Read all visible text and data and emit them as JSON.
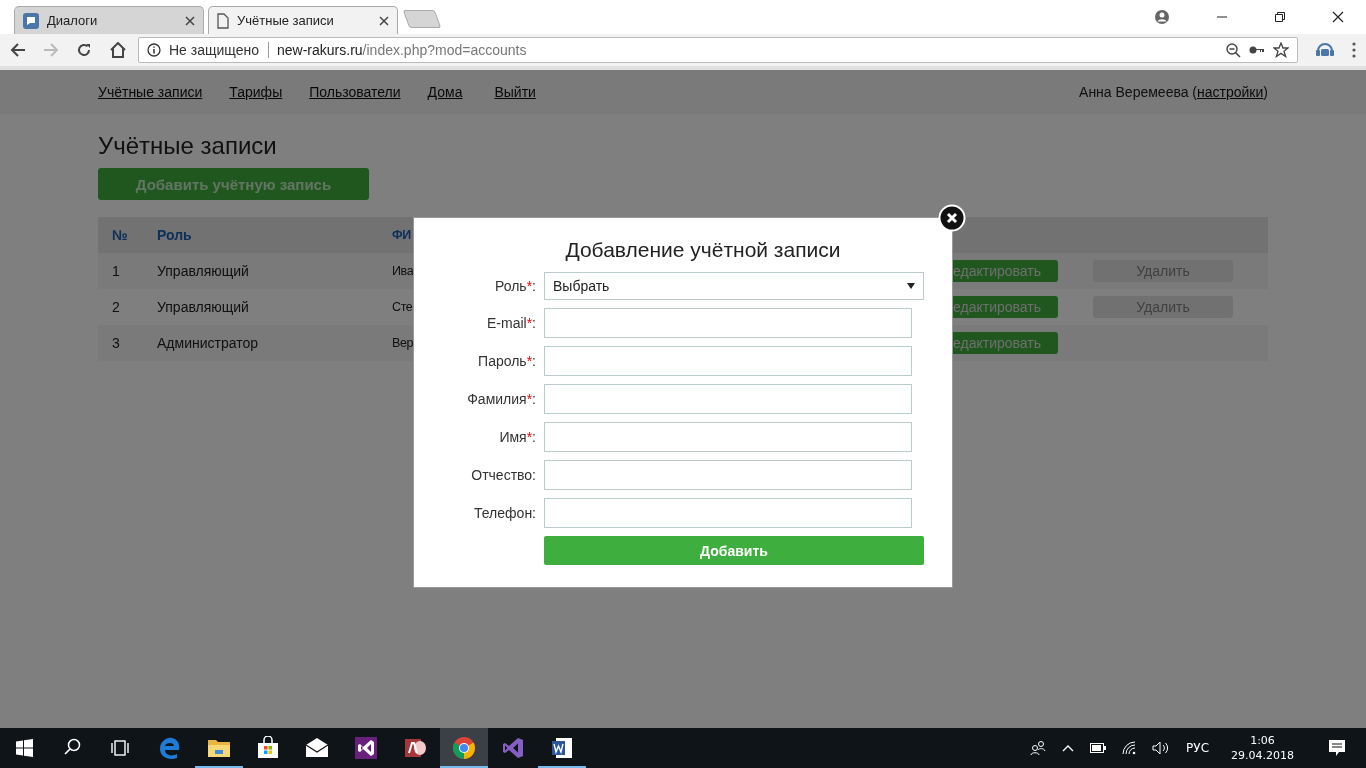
{
  "browser": {
    "tabs": [
      {
        "title": "Диалоги",
        "kind": "chat",
        "selected": false
      },
      {
        "title": "Учётные записи",
        "kind": "page",
        "selected": true
      }
    ],
    "address": {
      "security": "Не защищено",
      "host": "new-rakurs.ru",
      "path": "/index.php?mod=accounts"
    }
  },
  "nav": {
    "links": [
      "Учётные записи",
      "Тарифы",
      "Пользователи",
      "Дома",
      "Выйти"
    ],
    "user": {
      "name": "Анна Веремеева (",
      "link": "настройки",
      "end": ")"
    }
  },
  "page": {
    "title": "Учётные записи",
    "add_button": "Добавить учётную запись",
    "table": {
      "columns": [
        "№",
        "Роль",
        "ФИ"
      ],
      "rows": [
        {
          "number": "1",
          "role": "Управляющий",
          "name": "Ива",
          "edit": "едактировать",
          "delete": "Удалить"
        },
        {
          "number": "2",
          "role": "Управляющий",
          "name": "Сте",
          "edit": "едактировать",
          "delete": "Удалить"
        },
        {
          "number": "3",
          "role": "Администратор",
          "name": "Вер",
          "edit": "едактировать"
        }
      ]
    }
  },
  "dialog": {
    "title": "Добавление учётной записи",
    "fields": [
      {
        "kind": "select",
        "label": "Роль",
        "required_mark": "*",
        "label_end": ":",
        "value": "Выбрать"
      },
      {
        "kind": "input",
        "label": "E-mail",
        "required_mark": "*",
        "label_end": ":"
      },
      {
        "kind": "input",
        "label": "Пароль",
        "required_mark": "*",
        "label_end": ":"
      },
      {
        "kind": "input",
        "label": "Фамилия",
        "required_mark": "*",
        "label_end": ":"
      },
      {
        "kind": "input",
        "label": "Имя",
        "required_mark": "*",
        "label_end": ":"
      },
      {
        "kind": "input",
        "label": "Отчество:"
      },
      {
        "kind": "input",
        "label": "Телефон:"
      }
    ],
    "submit": "Добавить"
  },
  "taskbar": {
    "apps": [
      {
        "kind": "edge",
        "open": false,
        "selected": false
      },
      {
        "kind": "explorer",
        "open": true,
        "selected": false
      },
      {
        "kind": "store",
        "open": false,
        "selected": false
      },
      {
        "kind": "mail",
        "open": false,
        "selected": false
      },
      {
        "kind": "vs",
        "open": false,
        "selected": false
      },
      {
        "kind": "access",
        "open": false,
        "selected": false
      },
      {
        "kind": "chrome",
        "open": true,
        "selected": true
      },
      {
        "kind": "vs2",
        "open": false,
        "selected": false
      },
      {
        "kind": "word",
        "open": true,
        "selected": false
      }
    ],
    "language": "РУС",
    "time": "1:06",
    "date": "29.04.2018"
  }
}
